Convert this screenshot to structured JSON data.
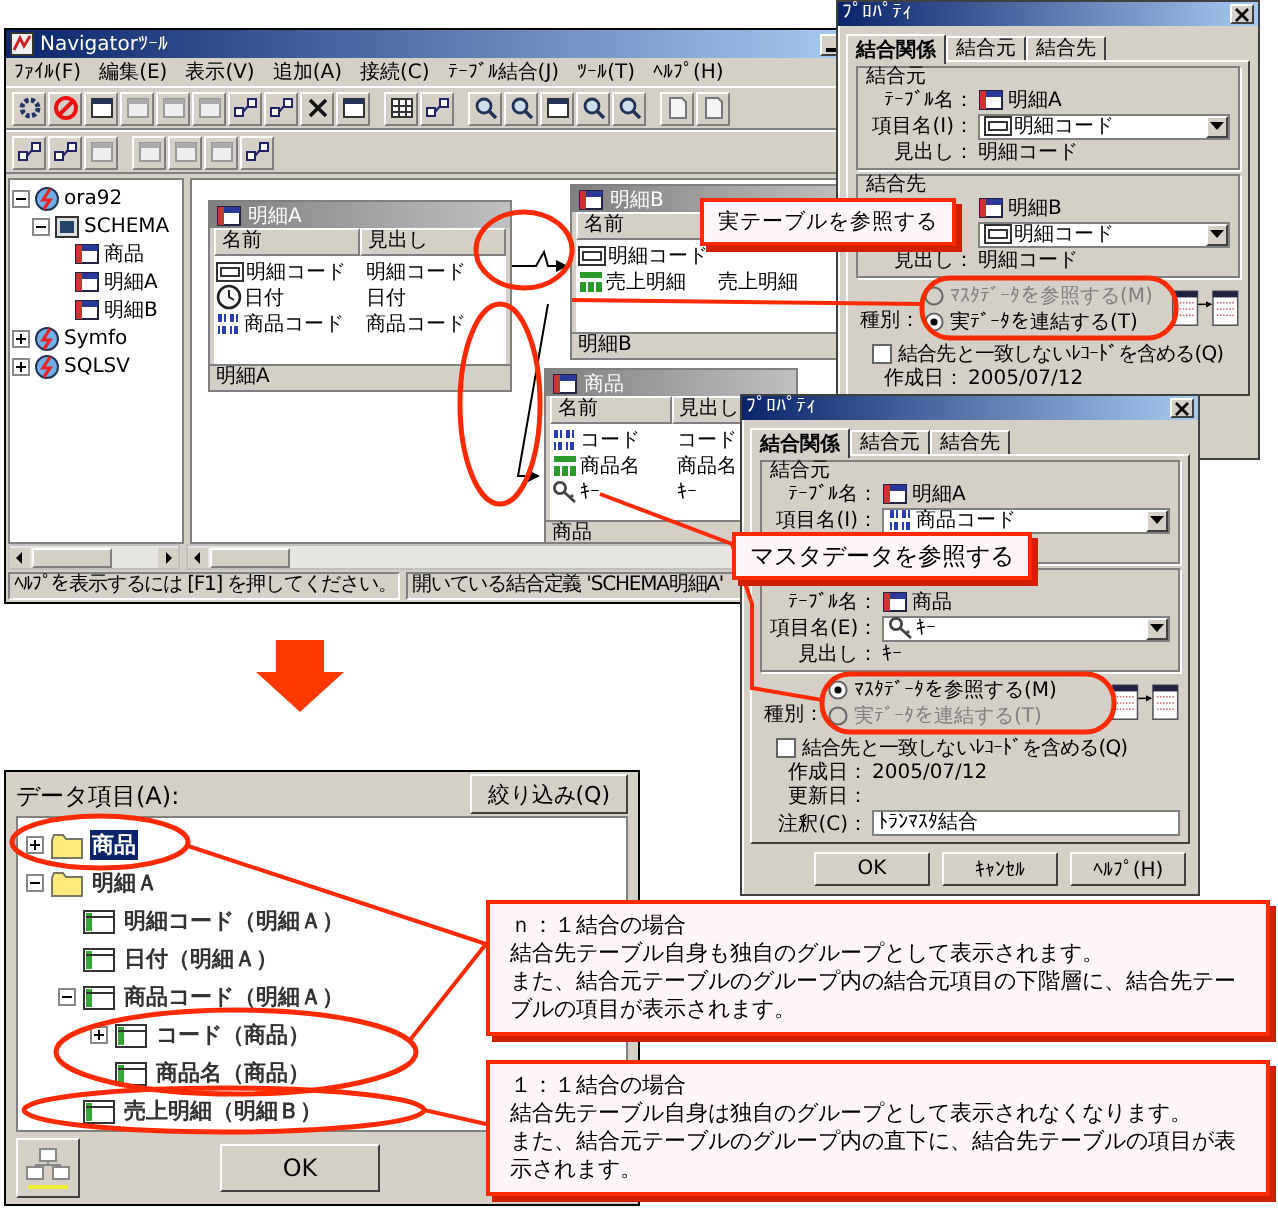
{
  "main_window": {
    "title": "Navigatorﾂｰﾙ",
    "menu": [
      "ﾌｧｲﾙ(F)",
      "編集(E)",
      "表示(V)",
      "追加(A)",
      "接続(C)",
      "ﾃｰﾌﾞﾙ結合(J)",
      "ﾂｰﾙ(T)",
      "ﾍﾙﾌﾟ(H)"
    ],
    "tree": [
      {
        "label": "ora92",
        "kind": "database",
        "expanded": true,
        "children": [
          {
            "label": "SCHEMA",
            "kind": "schema",
            "expanded": true,
            "children": [
              {
                "label": "商品",
                "kind": "table"
              },
              {
                "label": "明細A",
                "kind": "table"
              },
              {
                "label": "明細B",
                "kind": "table"
              }
            ]
          }
        ]
      },
      {
        "label": "Symfo",
        "kind": "database",
        "expanded": false
      },
      {
        "label": "SQLSV",
        "kind": "database",
        "expanded": false
      }
    ],
    "tables": [
      {
        "title": "明細A",
        "columns": [
          "名前",
          "見出し"
        ],
        "rows": [
          {
            "kind": "code",
            "name": "明細コード",
            "heading": "明細コード"
          },
          {
            "kind": "date",
            "name": "日付",
            "heading": "日付"
          },
          {
            "kind": "binary",
            "name": "商品コード",
            "heading": "商品コード"
          }
        ],
        "footer": "明細A"
      },
      {
        "title": "明細B",
        "columns": [
          "名前"
        ],
        "rows": [
          {
            "kind": "code",
            "name": "明細コード"
          },
          {
            "kind": "number",
            "name": "売上明細",
            "heading": "売上明細"
          }
        ],
        "footer": "明細B"
      },
      {
        "title": "商品",
        "columns": [
          "名前",
          "見出し"
        ],
        "rows": [
          {
            "kind": "binary",
            "name": "コード",
            "heading": "コード"
          },
          {
            "kind": "number",
            "name": "商品名",
            "heading": "商品名"
          },
          {
            "kind": "key",
            "name": "ｷｰ",
            "heading": "ｷｰ"
          }
        ],
        "footer": "商品"
      }
    ],
    "status_bar": [
      "ﾍﾙﾌﾟを表示するには [F1] を押してください。",
      "開いている結合定義 'SCHEMA明細A'"
    ]
  },
  "dialogs": [
    {
      "title": "ﾌﾟﾛﾊﾟﾃｨ",
      "tabs": [
        {
          "label": "結合関係",
          "selected": true
        },
        {
          "label": "結合元",
          "selected": false
        },
        {
          "label": "結合先",
          "selected": false
        }
      ],
      "groups": [
        {
          "caption": "結合元",
          "rows": [
            {
              "kind": "table",
              "label": "ﾃｰﾌﾞﾙ名：",
              "value": "明細A"
            },
            {
              "kind": "combo",
              "label": "項目名(I)：",
              "value": "明細コード"
            },
            {
              "kind": "text",
              "label": "見出し：",
              "value": "明細コード"
            }
          ]
        },
        {
          "caption": "結合先",
          "rows": [
            {
              "kind": "table",
              "value": "明細B"
            },
            {
              "kind": "combo",
              "value": "明細コード"
            },
            {
              "kind": "text",
              "label": "見出し：",
              "value": "明細コード"
            }
          ]
        }
      ],
      "kind_label": "種別：",
      "options": [
        {
          "label": "ﾏｽﾀﾃﾞｰﾀを参照する(M)",
          "selected": false,
          "disabled": true
        },
        {
          "label": "実ﾃﾞｰﾀを連結する(T)",
          "selected": true,
          "disabled": false
        }
      ],
      "checkbox": {
        "label": "結合先と一致しないﾚｺｰﾄﾞを含める(Q)",
        "checked": false
      },
      "info": [
        {
          "kind": "text",
          "label": "作成日：",
          "value": "2005/07/12"
        }
      ]
    },
    {
      "title": "ﾌﾟﾛﾊﾟﾃｨ",
      "tabs": [
        {
          "label": "結合関係",
          "selected": true
        },
        {
          "label": "結合元",
          "selected": false
        },
        {
          "label": "結合先",
          "selected": false
        }
      ],
      "groups": [
        {
          "caption": "結合元",
          "rows": [
            {
              "kind": "table",
              "label": "ﾃｰﾌﾞﾙ名：",
              "value": "明細A"
            },
            {
              "kind": "combo",
              "label": "項目名(I)：",
              "value": "商品コード"
            },
            {
              "kind": "text"
            }
          ]
        },
        {
          "rows": [
            {
              "kind": "table",
              "label": "ﾃｰﾌﾞﾙ名：",
              "value": "商品"
            },
            {
              "kind": "combo",
              "label": "項目名(E)：",
              "value": "ｷｰ"
            },
            {
              "kind": "text",
              "label": "見出し：",
              "value": "ｷｰ"
            }
          ]
        }
      ],
      "kind_label": "種別：",
      "options": [
        {
          "label": "ﾏｽﾀﾃﾞｰﾀを参照する(M)",
          "selected": true,
          "disabled": false
        },
        {
          "label": "実ﾃﾞｰﾀを連結する(T)",
          "selected": false,
          "disabled": true
        }
      ],
      "checkbox": {
        "label": "結合先と一致しないﾚｺｰﾄﾞを含める(Q)",
        "checked": false
      },
      "info": [
        {
          "kind": "text",
          "label": "作成日：",
          "value": "2005/07/12"
        },
        {
          "kind": "text",
          "label": "更新日："
        },
        {
          "kind": "field",
          "label": "注釈(C)：",
          "value": "ﾄﾗﾝﾏｽﾀ結合"
        }
      ],
      "buttons": [
        "OK",
        "ｷｬﾝｾﾙ",
        "ﾍﾙﾌﾟ(H)"
      ]
    }
  ],
  "callouts": [
    {
      "text": "実テーブルを参照する"
    },
    {
      "text": "マスタデータを参照する"
    }
  ],
  "items_dialog": {
    "label": "データ項目(A):",
    "filter_button": "絞り込み(Q)",
    "tree": [
      {
        "label": "商品",
        "kind": "folder",
        "expanded": false,
        "selected": true
      },
      {
        "label": "明細Ａ",
        "kind": "folder",
        "expanded": true,
        "selected": false,
        "children": [
          {
            "label": "明細コード（明細Ａ）",
            "kind": "column",
            "selected": false
          },
          {
            "label": "日付（明細Ａ）",
            "kind": "column",
            "selected": false
          },
          {
            "label": "商品コード（明細Ａ）",
            "kind": "column",
            "expanded": true,
            "selected": false,
            "children": [
              {
                "label": "コード（商品）",
                "kind": "column",
                "expanded": false,
                "selected": false
              },
              {
                "label": "商品名（商品）",
                "kind": "column",
                "selected": false
              }
            ]
          },
          {
            "label": "売上明細（明細Ｂ）",
            "kind": "column",
            "selected": false
          }
        ]
      }
    ],
    "ok_button": "OK"
  },
  "notes": [
    {
      "title": "ｎ：１結合の場合",
      "lines": [
        "結合先テーブル自身も独自のグループとして表示されます。",
        "また、結合元テーブルのグループ内の結合元項目の下階層に、結合先テーブルの項目が表示されます。"
      ]
    },
    {
      "title": "１：１結合の場合",
      "lines": [
        "結合先テーブル自身は独自のグループとして表示されなくなります。",
        "また、結合元テーブルのグループ内の直下に、結合先テーブルの項目が表示されます。"
      ]
    }
  ]
}
